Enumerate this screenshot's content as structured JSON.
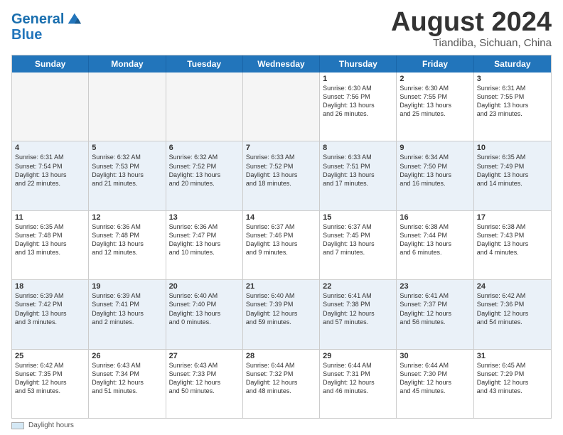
{
  "header": {
    "logo_line1": "General",
    "logo_line2": "Blue",
    "month_title": "August 2024",
    "location": "Tiandiba, Sichuan, China"
  },
  "day_headers": [
    "Sunday",
    "Monday",
    "Tuesday",
    "Wednesday",
    "Thursday",
    "Friday",
    "Saturday"
  ],
  "weeks": [
    [
      {
        "day": "",
        "info": ""
      },
      {
        "day": "",
        "info": ""
      },
      {
        "day": "",
        "info": ""
      },
      {
        "day": "",
        "info": ""
      },
      {
        "day": "1",
        "info": "Sunrise: 6:30 AM\nSunset: 7:56 PM\nDaylight: 13 hours\nand 26 minutes."
      },
      {
        "day": "2",
        "info": "Sunrise: 6:30 AM\nSunset: 7:55 PM\nDaylight: 13 hours\nand 25 minutes."
      },
      {
        "day": "3",
        "info": "Sunrise: 6:31 AM\nSunset: 7:55 PM\nDaylight: 13 hours\nand 23 minutes."
      }
    ],
    [
      {
        "day": "4",
        "info": "Sunrise: 6:31 AM\nSunset: 7:54 PM\nDaylight: 13 hours\nand 22 minutes."
      },
      {
        "day": "5",
        "info": "Sunrise: 6:32 AM\nSunset: 7:53 PM\nDaylight: 13 hours\nand 21 minutes."
      },
      {
        "day": "6",
        "info": "Sunrise: 6:32 AM\nSunset: 7:52 PM\nDaylight: 13 hours\nand 20 minutes."
      },
      {
        "day": "7",
        "info": "Sunrise: 6:33 AM\nSunset: 7:52 PM\nDaylight: 13 hours\nand 18 minutes."
      },
      {
        "day": "8",
        "info": "Sunrise: 6:33 AM\nSunset: 7:51 PM\nDaylight: 13 hours\nand 17 minutes."
      },
      {
        "day": "9",
        "info": "Sunrise: 6:34 AM\nSunset: 7:50 PM\nDaylight: 13 hours\nand 16 minutes."
      },
      {
        "day": "10",
        "info": "Sunrise: 6:35 AM\nSunset: 7:49 PM\nDaylight: 13 hours\nand 14 minutes."
      }
    ],
    [
      {
        "day": "11",
        "info": "Sunrise: 6:35 AM\nSunset: 7:48 PM\nDaylight: 13 hours\nand 13 minutes."
      },
      {
        "day": "12",
        "info": "Sunrise: 6:36 AM\nSunset: 7:48 PM\nDaylight: 13 hours\nand 12 minutes."
      },
      {
        "day": "13",
        "info": "Sunrise: 6:36 AM\nSunset: 7:47 PM\nDaylight: 13 hours\nand 10 minutes."
      },
      {
        "day": "14",
        "info": "Sunrise: 6:37 AM\nSunset: 7:46 PM\nDaylight: 13 hours\nand 9 minutes."
      },
      {
        "day": "15",
        "info": "Sunrise: 6:37 AM\nSunset: 7:45 PM\nDaylight: 13 hours\nand 7 minutes."
      },
      {
        "day": "16",
        "info": "Sunrise: 6:38 AM\nSunset: 7:44 PM\nDaylight: 13 hours\nand 6 minutes."
      },
      {
        "day": "17",
        "info": "Sunrise: 6:38 AM\nSunset: 7:43 PM\nDaylight: 13 hours\nand 4 minutes."
      }
    ],
    [
      {
        "day": "18",
        "info": "Sunrise: 6:39 AM\nSunset: 7:42 PM\nDaylight: 13 hours\nand 3 minutes."
      },
      {
        "day": "19",
        "info": "Sunrise: 6:39 AM\nSunset: 7:41 PM\nDaylight: 13 hours\nand 2 minutes."
      },
      {
        "day": "20",
        "info": "Sunrise: 6:40 AM\nSunset: 7:40 PM\nDaylight: 13 hours\nand 0 minutes."
      },
      {
        "day": "21",
        "info": "Sunrise: 6:40 AM\nSunset: 7:39 PM\nDaylight: 12 hours\nand 59 minutes."
      },
      {
        "day": "22",
        "info": "Sunrise: 6:41 AM\nSunset: 7:38 PM\nDaylight: 12 hours\nand 57 minutes."
      },
      {
        "day": "23",
        "info": "Sunrise: 6:41 AM\nSunset: 7:37 PM\nDaylight: 12 hours\nand 56 minutes."
      },
      {
        "day": "24",
        "info": "Sunrise: 6:42 AM\nSunset: 7:36 PM\nDaylight: 12 hours\nand 54 minutes."
      }
    ],
    [
      {
        "day": "25",
        "info": "Sunrise: 6:42 AM\nSunset: 7:35 PM\nDaylight: 12 hours\nand 53 minutes."
      },
      {
        "day": "26",
        "info": "Sunrise: 6:43 AM\nSunset: 7:34 PM\nDaylight: 12 hours\nand 51 minutes."
      },
      {
        "day": "27",
        "info": "Sunrise: 6:43 AM\nSunset: 7:33 PM\nDaylight: 12 hours\nand 50 minutes."
      },
      {
        "day": "28",
        "info": "Sunrise: 6:44 AM\nSunset: 7:32 PM\nDaylight: 12 hours\nand 48 minutes."
      },
      {
        "day": "29",
        "info": "Sunrise: 6:44 AM\nSunset: 7:31 PM\nDaylight: 12 hours\nand 46 minutes."
      },
      {
        "day": "30",
        "info": "Sunrise: 6:44 AM\nSunset: 7:30 PM\nDaylight: 12 hours\nand 45 minutes."
      },
      {
        "day": "31",
        "info": "Sunrise: 6:45 AM\nSunset: 7:29 PM\nDaylight: 12 hours\nand 43 minutes."
      }
    ]
  ],
  "footer": {
    "swatch_label": "Daylight hours"
  }
}
